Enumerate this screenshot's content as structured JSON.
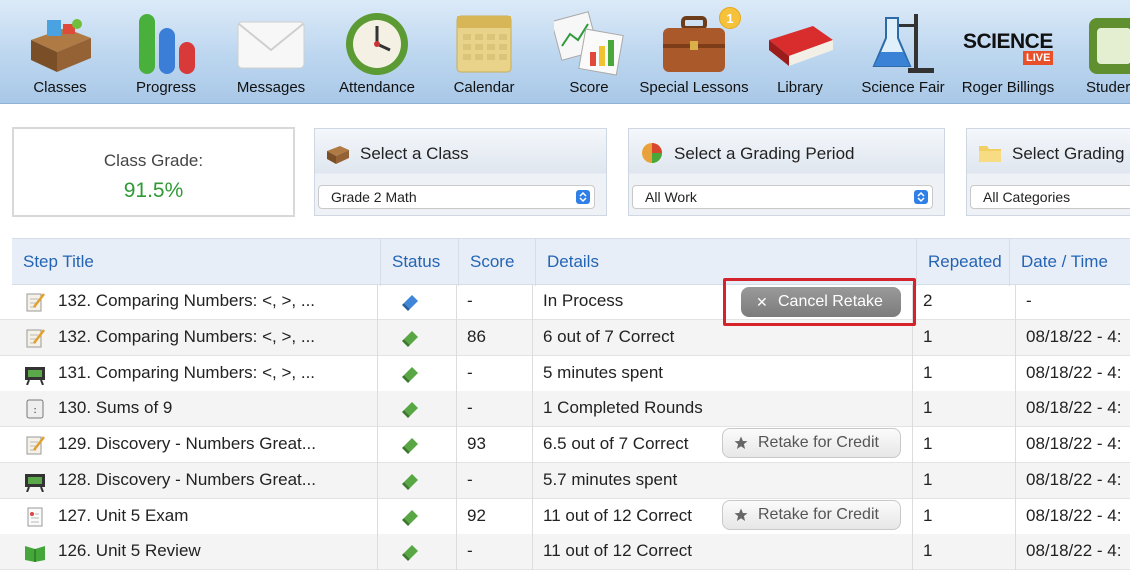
{
  "toolbar": {
    "items": [
      {
        "label": "Classes",
        "icon": "desk-icon"
      },
      {
        "label": "Progress",
        "icon": "progress-bars-icon"
      },
      {
        "label": "Messages",
        "icon": "envelope-icon"
      },
      {
        "label": "Attendance",
        "icon": "clock-icon"
      },
      {
        "label": "Calendar",
        "icon": "calendar-icon"
      },
      {
        "label": "Score",
        "icon": "score-charts-icon"
      },
      {
        "label": "Special Lessons",
        "icon": "briefcase-icon",
        "badge": "1"
      },
      {
        "label": "Library",
        "icon": "book-icon"
      },
      {
        "label": "Science Fair",
        "icon": "lab-flask-icon"
      },
      {
        "label": "Roger Billings",
        "icon": "science-live-logo",
        "logo_text": "SCIENCE",
        "logo_sub": "LIVE"
      },
      {
        "label": "Studer",
        "icon": "student-icon"
      }
    ]
  },
  "grade": {
    "label": "Class Grade:",
    "value": "91.5%"
  },
  "selectors": [
    {
      "title": "Select a Class",
      "value": "Grade 2 Math"
    },
    {
      "title": "Select a Grading Period",
      "value": "All Work"
    },
    {
      "title": "Select Grading C",
      "value": "All Categories"
    }
  ],
  "table": {
    "headers": [
      "Step Title",
      "Status",
      "Score",
      "Details",
      "Repeated",
      "Date / Time"
    ],
    "rows": [
      {
        "icon": "worksheet-icon",
        "title": "132. Comparing Numbers: <, >, ...",
        "status": "blue",
        "score": "-",
        "details": "In Process",
        "repeated": "2",
        "date": "-",
        "action": "Cancel Retake"
      },
      {
        "icon": "worksheet-icon",
        "title": "132. Comparing Numbers: <, >, ...",
        "status": "green",
        "score": "86",
        "details": "6 out of 7 Correct",
        "repeated": "1",
        "date": "08/18/22 - 4:"
      },
      {
        "icon": "video-icon",
        "title": "131. Comparing Numbers: <, >, ...",
        "status": "green",
        "score": "-",
        "details": "5 minutes spent",
        "repeated": "1",
        "date": "08/18/22 - 4:"
      },
      {
        "icon": "game-icon",
        "title": "130. Sums of 9",
        "status": "green",
        "score": "-",
        "details": "1 Completed Rounds",
        "repeated": "1",
        "date": "08/18/22 - 4:"
      },
      {
        "icon": "worksheet-icon",
        "title": "129. Discovery - Numbers Great...",
        "status": "green",
        "score": "93",
        "details": "6.5 out of 7 Correct",
        "repeated": "1",
        "date": "08/18/22 - 4:",
        "action": "Retake for Credit"
      },
      {
        "icon": "video-icon",
        "title": "128. Discovery - Numbers Great...",
        "status": "green",
        "score": "-",
        "details": "5.7 minutes spent",
        "repeated": "1",
        "date": "08/18/22 - 4:"
      },
      {
        "icon": "exam-icon",
        "title": "127. Unit 5 Exam",
        "status": "green",
        "score": "92",
        "details": "11 out of 12 Correct",
        "repeated": "1",
        "date": "08/18/22 - 4:",
        "action": "Retake for Credit"
      },
      {
        "icon": "review-book-icon",
        "title": "126. Unit 5 Review",
        "status": "green",
        "score": "-",
        "details": "11 out of 12 Correct",
        "repeated": "1",
        "date": "08/18/22 - 4:"
      }
    ]
  },
  "colors": {
    "accent_blue": "#2464b4",
    "grade_green": "#2f9a35",
    "highlight_red": "#d4232b"
  }
}
